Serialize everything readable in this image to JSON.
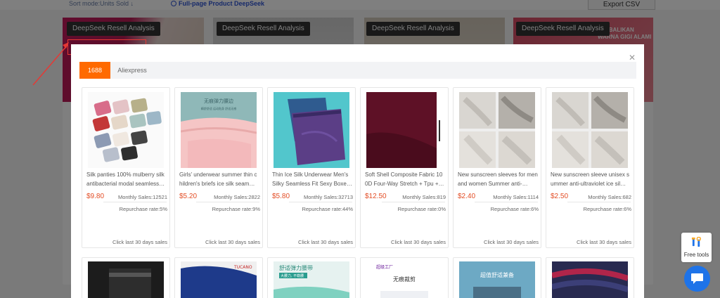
{
  "background": {
    "sort_mode": "Sort mode:Units Sold ↓",
    "full_page_deepseek": "Full-page Product DeepSeek",
    "export_csv": "Export CSV",
    "resell_label": "DeepSeek Resell Analysis",
    "fragments": {
      "kembalikan": "KEMBALIKAN",
      "warna": "WARNA GIGI ALAMI"
    }
  },
  "modal": {
    "close_icon": "close-icon",
    "tabs": [
      {
        "label": "1688",
        "active": true
      },
      {
        "label": "Aliexpress",
        "active": false
      }
    ],
    "products": [
      {
        "title": "Silk panties 100% mulberry silk antibacterial modal seamless…",
        "price": "$9.80",
        "monthly": "Monthly Sales:12521",
        "repurchase": "Repurchase rate:5%",
        "click": "Click last 30 days sales"
      },
      {
        "title": "Girls' underwear summer thin children's briefs ice silk seam…",
        "price": "$5.20",
        "monthly": "Monthly Sales:2822",
        "repurchase": "Repurchase rate:9%",
        "click": "Click last 30 days sales",
        "img_text_1": "无痕弹力腰边",
        "img_text_2": "精舒舒适 运动贴身 舒适无感"
      },
      {
        "title": "Thin Ice Silk Underwear Men's Silky Seamless Fit Sexy Boxe…",
        "price": "$5.80",
        "monthly": "Monthly Sales:32713",
        "repurchase": "Repurchase rate:44%",
        "click": "Click last 30 days sales"
      },
      {
        "title": "Soft Shell Composite Fabric 100D Four-Way Stretch + Tpu + …",
        "price": "$12.50",
        "monthly": "Monthly Sales:819",
        "repurchase": "Repurchase rate:0%",
        "click": "Click last 30 days sales"
      },
      {
        "title": "New sunscreen sleeves for men and women Summer anti-…",
        "price": "$2.40",
        "monthly": "Monthly Sales:1114",
        "repurchase": "Repurchase rate:6%",
        "click": "Click last 30 days sales"
      },
      {
        "title": "New sunscreen sleeve unisex summer anti-ultraviolet ice sil…",
        "price": "$2.50",
        "monthly": "Monthly Sales:682",
        "repurchase": "Repurchase rate:6%",
        "click": "Click last 30 days sales"
      }
    ],
    "row2": [
      {
        "img_text": "TUCANO"
      },
      {
        "img_text_1": "舒适弹力腰带",
        "img_text_2": "大腰力, 不勒腰"
      },
      {
        "img_text_1": "超级工厂",
        "img_text_2": "无痕裁剪"
      },
      {
        "img_text": "超值舒适兼备"
      }
    ]
  },
  "widgets": {
    "free_tools_label": "Free tools",
    "chat_icon": "chat-bubble-icon"
  },
  "colors": {
    "accent": "#ff6a00",
    "price": "#e34d25",
    "annotation": "#e53935",
    "chat": "#1e73e8"
  }
}
